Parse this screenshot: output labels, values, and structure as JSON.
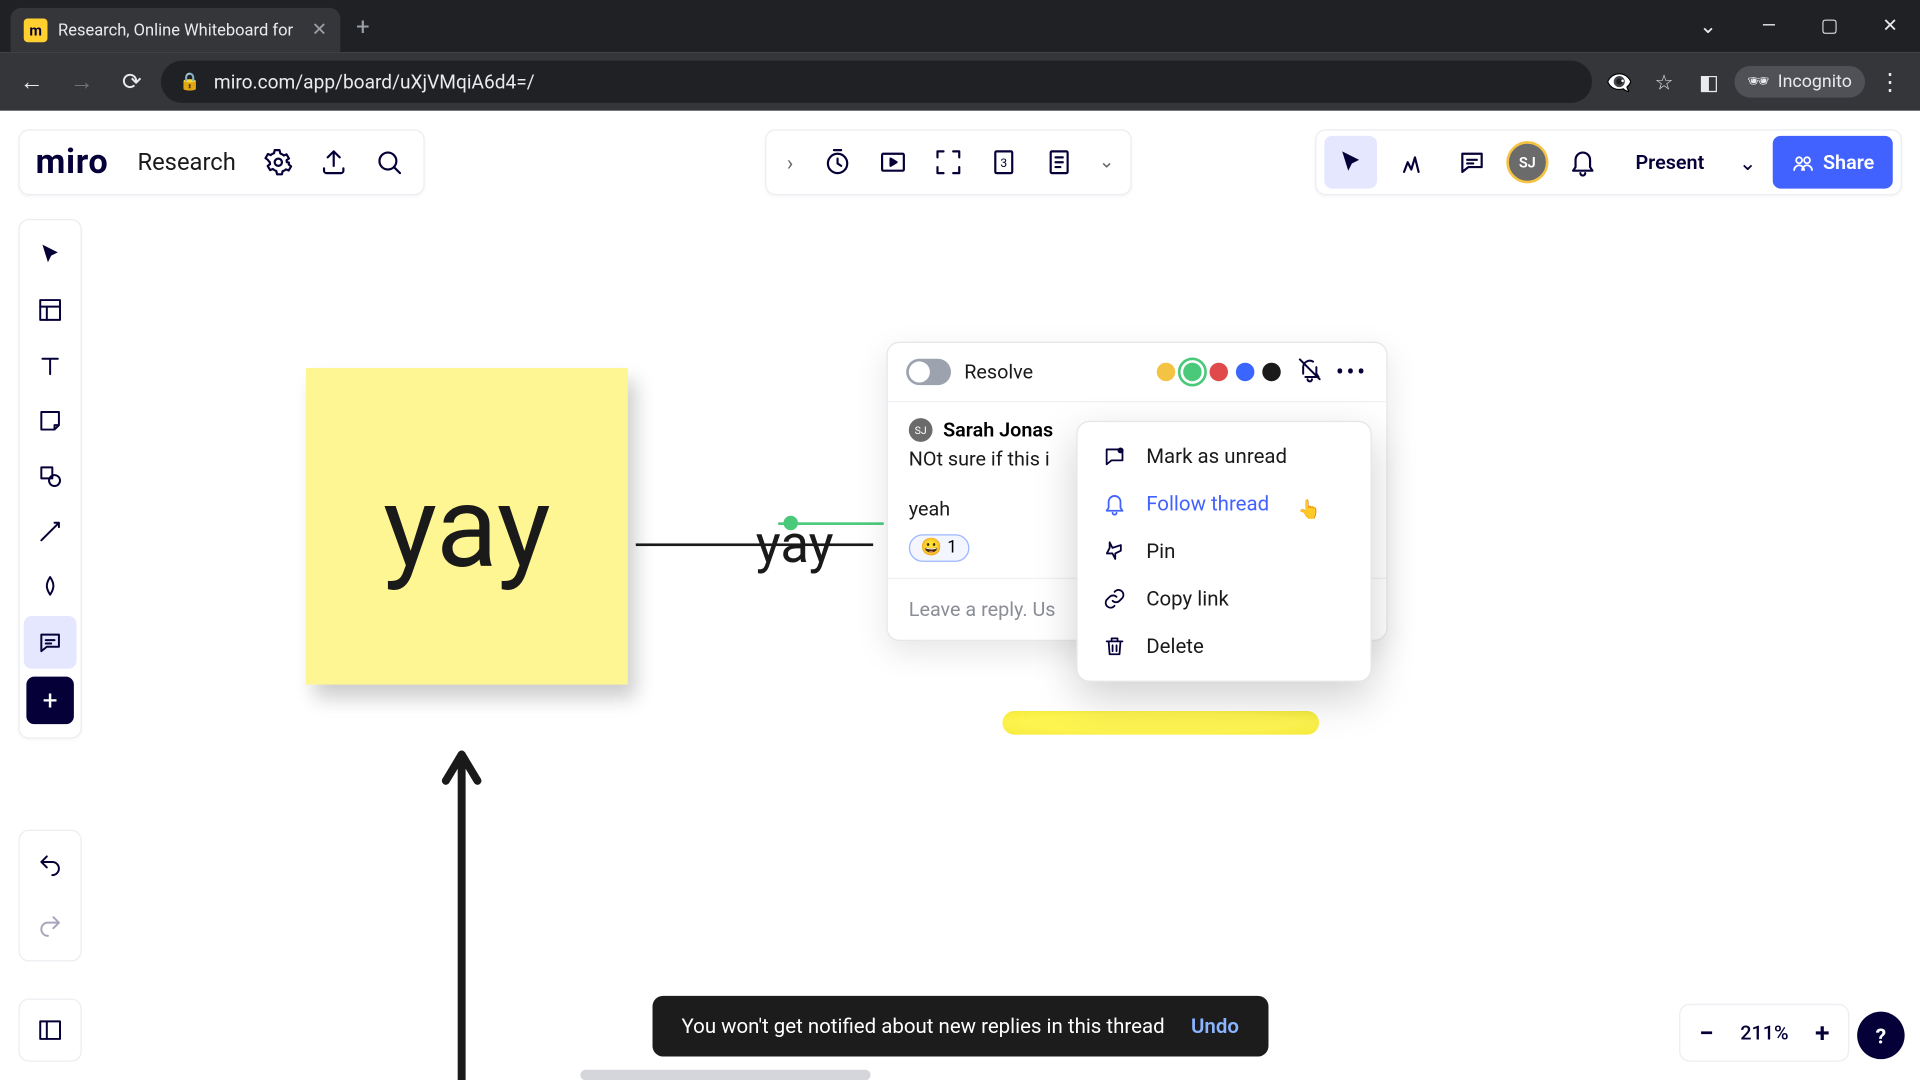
{
  "browser": {
    "tab_title": "Research, Online Whiteboard for",
    "url": "miro.com/app/board/uXjVMqiA6d4=/",
    "incognito_label": "Incognito"
  },
  "header": {
    "logo_text": "miro",
    "board_name": "Research",
    "present_label": "Present",
    "share_label": "Share",
    "user_initials": "SJ"
  },
  "canvas": {
    "sticky_text": "yay",
    "floating_text": "yay"
  },
  "comment": {
    "resolve_label": "Resolve",
    "author": "Sarah Jonas",
    "body1": "NOt sure if this i",
    "body2": "yeah",
    "reaction_emoji": "😀",
    "reaction_count": "1",
    "reply_placeholder": "Leave a reply. Us",
    "colors": [
      "#f5c344",
      "#4bc97b",
      "#e14a4a",
      "#3a66ff",
      "#1a1a1a"
    ]
  },
  "context_menu": {
    "items": [
      {
        "label": "Mark as unread"
      },
      {
        "label": "Follow thread"
      },
      {
        "label": "Pin"
      },
      {
        "label": "Copy link"
      },
      {
        "label": "Delete"
      }
    ]
  },
  "toast": {
    "message": "You won't get notified about new replies in this thread",
    "action": "Undo"
  },
  "zoom": {
    "level": "211%"
  }
}
